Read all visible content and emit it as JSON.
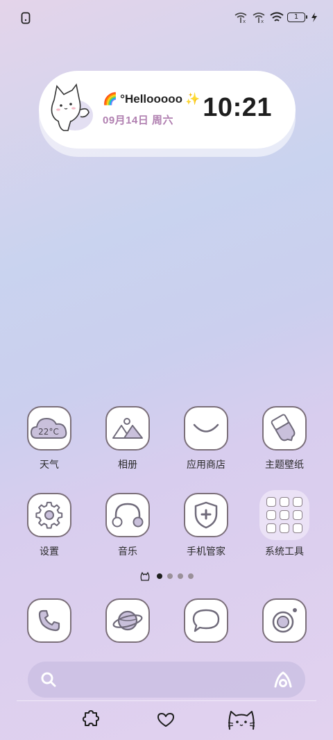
{
  "status_bar": {
    "battery_level": "1",
    "icons": [
      "phone-notch-icon",
      "signal-none-icon",
      "signal-none-icon",
      "wifi-icon",
      "battery-icon",
      "charging-bolt-icon"
    ]
  },
  "widget": {
    "greeting": "°Hellooooo",
    "greeting_prefix_emoji": "🌈",
    "greeting_suffix_emoji": "✨",
    "date": "09月14日 周六",
    "time": "10:21"
  },
  "apps": [
    {
      "label": "天气",
      "icon": "weather-cloud-icon",
      "temp": "22°C"
    },
    {
      "label": "相册",
      "icon": "gallery-mountain-icon"
    },
    {
      "label": "应用商店",
      "icon": "app-store-smile-icon"
    },
    {
      "label": "主题壁纸",
      "icon": "theme-brush-icon"
    },
    {
      "label": "设置",
      "icon": "gear-icon"
    },
    {
      "label": "音乐",
      "icon": "headphones-icon"
    },
    {
      "label": "手机管家",
      "icon": "shield-plus-icon"
    },
    {
      "label": "系统工具",
      "icon": "folder-icon"
    }
  ],
  "page_indicator": {
    "count": 4,
    "active": 0,
    "leading_icon": "home-screen-cat-icon"
  },
  "dock": [
    {
      "name": "phone",
      "icon": "phone-icon"
    },
    {
      "name": "browser",
      "icon": "planet-icon"
    },
    {
      "name": "messages",
      "icon": "chat-bubble-icon"
    },
    {
      "name": "camera",
      "icon": "camera-icon"
    }
  ],
  "search": {
    "icon": "search-icon",
    "assistant_icon": "assistant-a-icon"
  },
  "bottom_nav": [
    "puzzle-icon",
    "heart-icon",
    "cat-face-icon"
  ],
  "colors": {
    "accent": "#b07fb0",
    "icon_border": "#7b6f79",
    "icon_fill": "#c9c0db"
  }
}
